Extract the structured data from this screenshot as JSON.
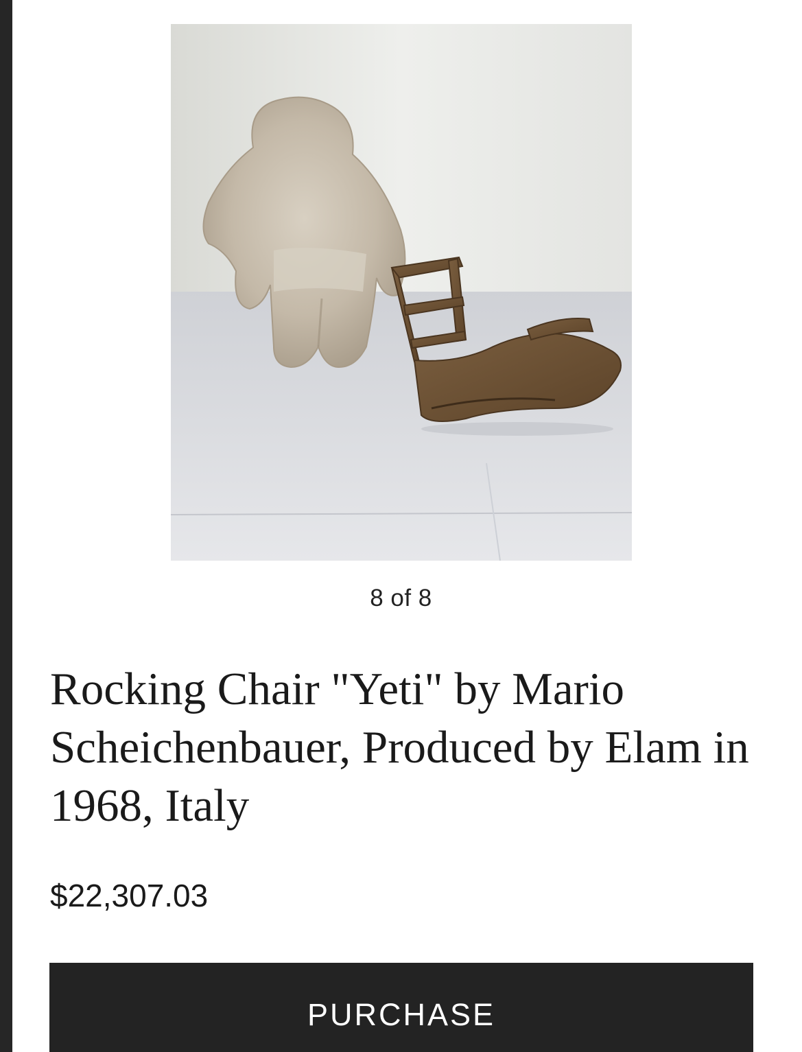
{
  "gallery": {
    "counter": "8 of 8",
    "image_alt": "Rocking Chair Yeti photo"
  },
  "product": {
    "title": "Rocking Chair \"Yeti\" by Mario Scheichenbauer, Produced by Elam in 1968, Italy",
    "price": "$22,307.03"
  },
  "actions": {
    "purchase_label": "PURCHASE"
  },
  "colors": {
    "button_bg": "#232323",
    "button_text": "#ffffff",
    "text": "#1a1a1a"
  }
}
